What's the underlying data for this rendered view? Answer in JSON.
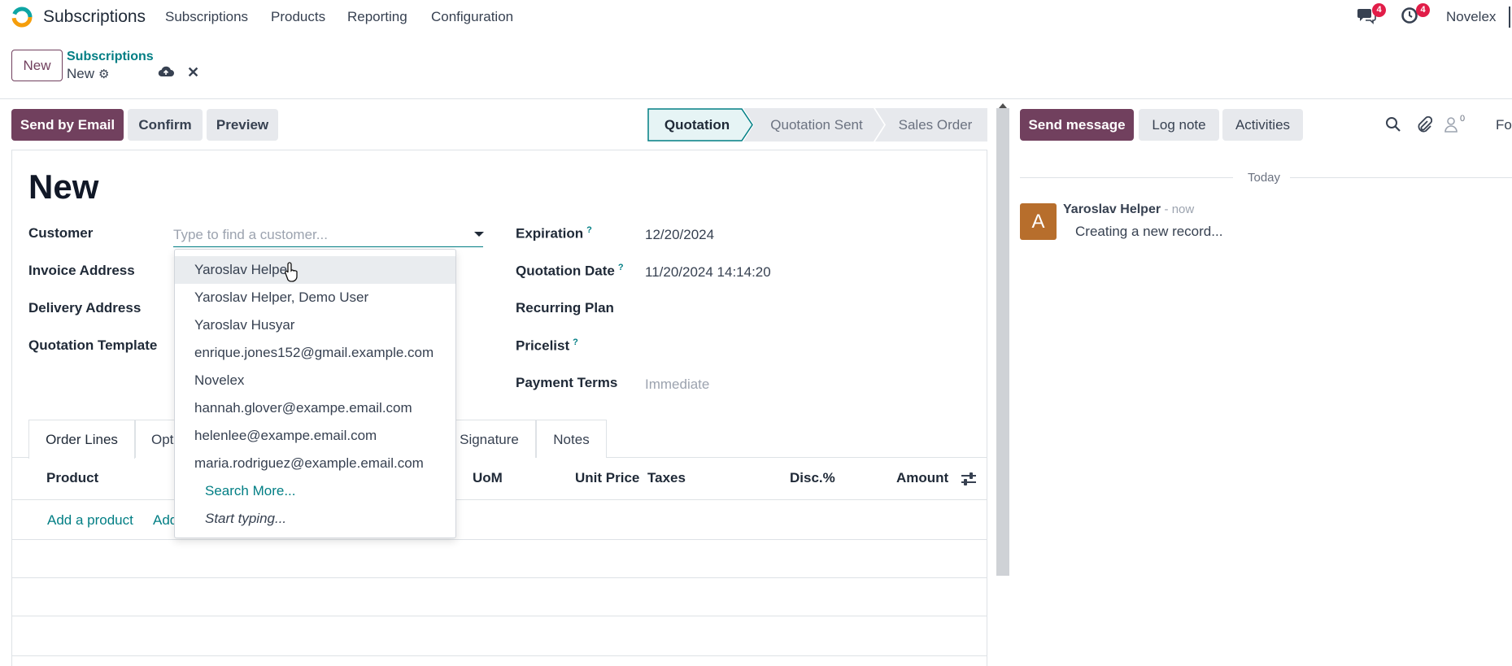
{
  "navbar": {
    "app_name": "Subscriptions",
    "menu": [
      "Subscriptions",
      "Products",
      "Reporting",
      "Configuration"
    ],
    "messages_count": "4",
    "activities_count": "4",
    "company": "Novelex"
  },
  "control_panel": {
    "new_label": "New",
    "breadcrumb_parent": "Subscriptions",
    "breadcrumb_current": "New"
  },
  "actions": {
    "send_email": "Send by Email",
    "confirm": "Confirm",
    "preview": "Preview"
  },
  "statusbar": {
    "steps": [
      "Quotation",
      "Quotation Sent",
      "Sales Order"
    ],
    "active": "Quotation"
  },
  "form": {
    "title": "New",
    "left_labels": {
      "customer": "Customer",
      "invoice_address": "Invoice Address",
      "delivery_address": "Delivery Address",
      "quotation_template": "Quotation Template"
    },
    "customer_placeholder": "Type to find a customer...",
    "right": {
      "expiration_label": "Expiration",
      "expiration_value": "12/20/2024",
      "quotation_date_label": "Quotation Date",
      "quotation_date_value": "11/20/2024 14:14:20",
      "recurring_plan_label": "Recurring Plan",
      "pricelist_label": "Pricelist",
      "payment_terms_label": "Payment Terms",
      "payment_terms_value": "Immediate"
    },
    "help_mark": "?"
  },
  "tabs": [
    "Order Lines",
    "Opt",
    "Signature",
    "Notes"
  ],
  "table": {
    "headers": [
      "Product",
      "UoM",
      "Unit Price",
      "Taxes",
      "Disc.%",
      "Amount"
    ],
    "add_product": "Add a product",
    "add_section_partial": "Add"
  },
  "dropdown": {
    "items": [
      "Yaroslav Helper",
      "Yaroslav Helper, Demo User",
      "Yaroslav Husyar",
      "enrique.jones152@gmail.example.com",
      "Novelex",
      "hannah.glover@exampe.email.com",
      "helenlee@exampe.email.com",
      "maria.rodriguez@example.email.com"
    ],
    "search_more": "Search More...",
    "start_typing": "Start typing..."
  },
  "chatter": {
    "send_message": "Send message",
    "log_note": "Log note",
    "activities": "Activities",
    "followers_count": "0",
    "follow_partial": "Fo",
    "today": "Today",
    "avatar_letter": "A",
    "author": "Yaroslav Helper",
    "when": "- now",
    "message": "Creating a new record..."
  },
  "colors": {
    "primary": "#71405e",
    "accent": "#017e84",
    "badge": "#e11d48",
    "avatar": "#b76e2c"
  }
}
